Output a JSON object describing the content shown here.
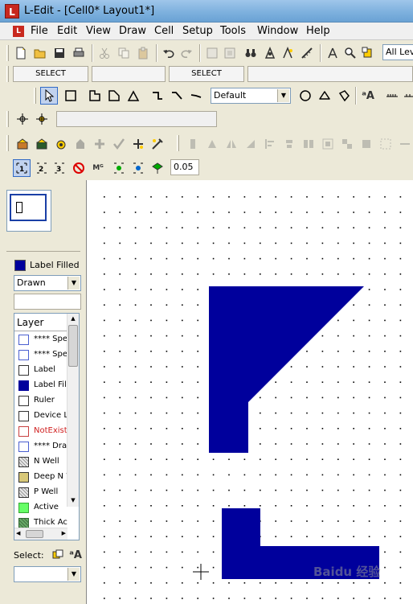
{
  "window": {
    "logo_letter": "L",
    "title": "L-Edit - [Cell0*     Layout1*]"
  },
  "menu": {
    "items": [
      "File",
      "Edit",
      "View",
      "Draw",
      "Cell",
      "Setup",
      "Tools",
      "Window",
      "Help"
    ]
  },
  "toolbar_main": {
    "level_combo": "All Leve"
  },
  "selection_bar": {
    "left_label": "SELECT",
    "right_label": "SELECT"
  },
  "drawing_toolbar": {
    "style_combo": "Default"
  },
  "snap_toolbar": {
    "value": "0.05"
  },
  "left_panel": {
    "current_layer": "Label Filled",
    "view_mode": "Drawn",
    "layer_header": "Layer",
    "select_label": "Select:",
    "layers": [
      {
        "name": "**** Spec",
        "color": "#ffffff",
        "border": "#4a5fd0",
        "text_color": "#000000"
      },
      {
        "name": "**** Spec",
        "color": "#ffffff",
        "border": "#4a5fd0",
        "text_color": "#000000"
      },
      {
        "name": "Label",
        "color": "#ffffff",
        "border": "#333333",
        "text_color": "#000000"
      },
      {
        "name": "Label Fille",
        "color": "#00009c",
        "border": "#00009c",
        "text_color": "#000000"
      },
      {
        "name": "Ruler",
        "color": "#ffffff",
        "border": "#333333",
        "text_color": "#000000"
      },
      {
        "name": "Device La",
        "color": "#ffffff",
        "border": "#333333",
        "text_color": "#000000"
      },
      {
        "name": "NotExists",
        "color": "#ffffff",
        "border": "#c84040",
        "text_color": "#d02020"
      },
      {
        "name": "**** Draw",
        "color": "#ffffff",
        "border": "#4a5fd0",
        "text_color": "#000000"
      },
      {
        "name": "N Well",
        "color": "#e8e8e8",
        "border": "#333333",
        "text_color": "#000000"
      },
      {
        "name": "Deep N W",
        "color": "#d8c878",
        "border": "#333333",
        "text_color": "#000000"
      },
      {
        "name": "P Well",
        "color": "#e8e8e8",
        "border": "#333333",
        "text_color": "#000000"
      },
      {
        "name": "Active",
        "color": "#66ff66",
        "border": "#33aa33",
        "text_color": "#000000"
      },
      {
        "name": "Thick Act",
        "color": "#66aa66",
        "border": "#336633",
        "text_color": "#000000"
      }
    ]
  },
  "layout": {
    "fill_color": "#00009c",
    "grid_color": "#000000"
  },
  "watermark": "Baidu 经验"
}
